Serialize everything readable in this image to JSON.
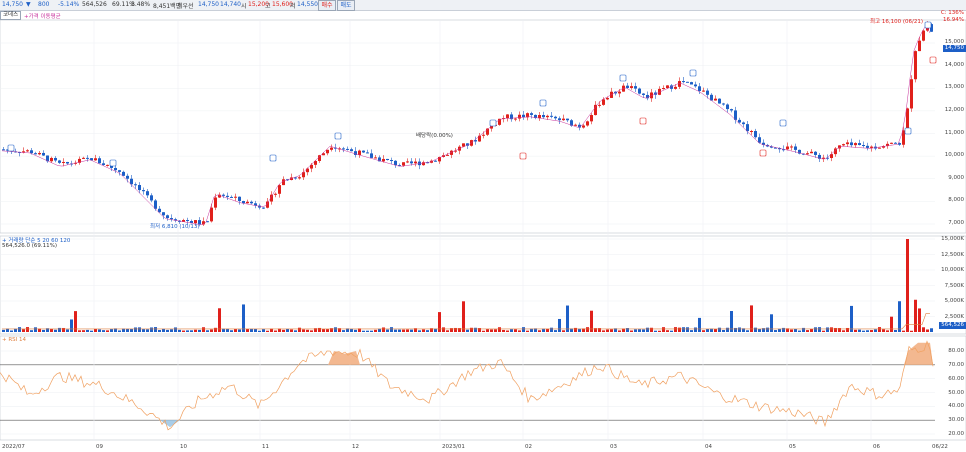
{
  "toolbar": {
    "price": "14,750",
    "arrow": "▼",
    "change": "800",
    "change_pct": "-5.14%",
    "volume": "564,526",
    "turnover_pct": "69.11%",
    "ratio": "3.48%",
    "amount": "8,451백만",
    "label_last": "최우선",
    "last": "14,750",
    "mid": "14,740",
    "label_high": "시",
    "open": "15,200",
    "label_g": "고",
    "high": "15,600",
    "label_low": "저",
    "low": "14,550",
    "buy_btn": "매수",
    "sell_btn": "매도"
  },
  "price_panel": {
    "tab": "코데스",
    "legend": "+가격 이동평균",
    "high_note": "최고 16,100 (06/21)",
    "low_note": "최저 6,810 (10/13)",
    "event_note": "배당락(0.00%)",
    "top_tag": "C: 136%",
    "top_tag2": "16.94%",
    "last_tag": "14,750",
    "y_ticks": [
      "15,000",
      "14,000",
      "13,000",
      "12,000",
      "11,000",
      "10,000",
      "9,000",
      "8,000",
      "7,000"
    ]
  },
  "volume_panel": {
    "legend": "+ 거래량  단순 5  20  60  120",
    "value": "564,526.0 (69.11%)",
    "y_ticks": [
      "15,000K",
      "12,500K",
      "10,000K",
      "7,500K",
      "5,000K",
      "2,500K"
    ],
    "last_tag": "564,526"
  },
  "rsi_panel": {
    "legend": "+ RSI 14",
    "y_ticks": [
      "80.00",
      "70.00",
      "60.00",
      "50.00",
      "40.00",
      "30.00",
      "20.00"
    ]
  },
  "x_labels": [
    "2022/07",
    "09",
    "10",
    "11",
    "12",
    "2023/01",
    "02",
    "03",
    "04",
    "05",
    "06",
    "06/22"
  ],
  "colors": {
    "up": "#e0201b",
    "down": "#1d5fc7",
    "rsi": "#f0a060",
    "rsi_fill": "#f3b890",
    "rsi_low": "#a9cde8"
  }
}
